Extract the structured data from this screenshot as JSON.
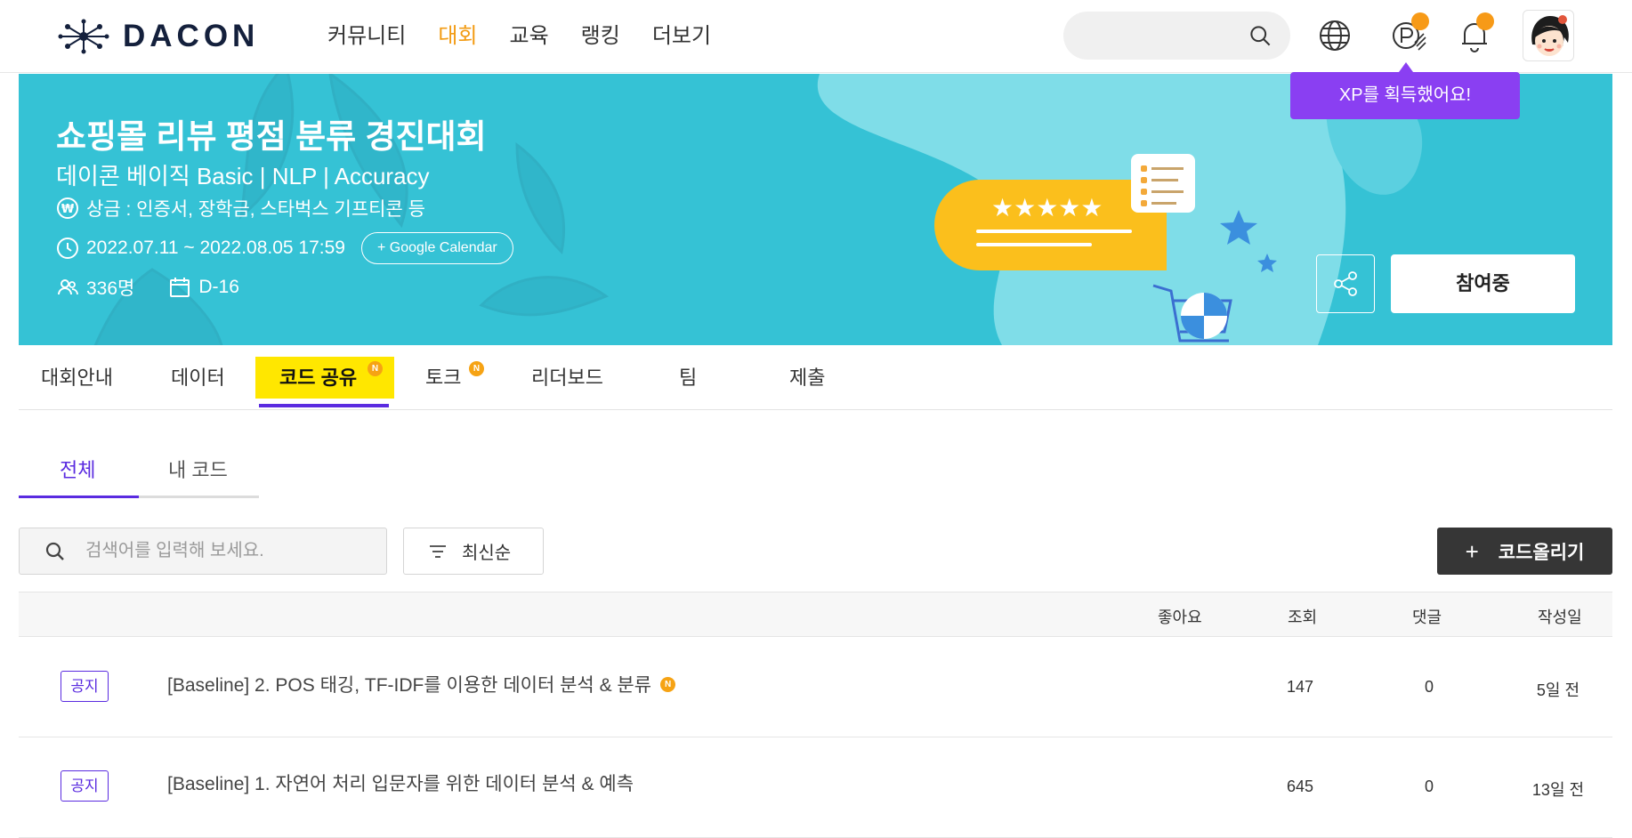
{
  "header": {
    "logo_text": "DACON",
    "menu": [
      "커뮤니티",
      "대회",
      "교육",
      "랭킹",
      "더보기"
    ],
    "xp_tooltip": "XP를 획득했어요!"
  },
  "banner": {
    "title": "쇼핑몰 리뷰 평점 분류 경진대회",
    "subtitle": "데이콘 베이직 Basic | NLP | Accuracy",
    "prize": "상금 : 인증서, 장학금, 스타벅스 기프티콘 등",
    "period": "2022.07.11 ~ 2022.08.05 17:59",
    "calendar_button": "+ Google Calendar",
    "participants": "336명",
    "dday": "D-16",
    "join_button": "참여중",
    "colors": {
      "background": "#35c2d5",
      "card": "#fbbf1c"
    }
  },
  "tabs": {
    "items": [
      "대회안내",
      "데이터",
      "코드 공유",
      "토크",
      "리더보드",
      "팀",
      "제출"
    ],
    "selected": "코드 공유",
    "badge": "N"
  },
  "subtabs": [
    "전체",
    "내 코드"
  ],
  "toolbar": {
    "search_placeholder": "검색어를 입력해 보세요.",
    "sort_label": "최신순",
    "upload_label": "코드올리기"
  },
  "table": {
    "headers": [
      "좋아요",
      "조회",
      "댓글",
      "작성일"
    ],
    "rows": [
      {
        "badge": "공지",
        "title": "[Baseline] 2. POS 태깅, TF-IDF를 이용한 데이터 분석 & 분류",
        "new": "N",
        "views": "147",
        "comments": "0",
        "date": "5일 전"
      },
      {
        "badge": "공지",
        "title": "[Baseline] 1. 자연어 처리 입문자를 위한 데이터 분석 & 예측",
        "views": "645",
        "comments": "0",
        "date": "13일 전"
      }
    ]
  },
  "accent": {
    "orange": "#f29b13",
    "purple": "#5a2be0",
    "tooltip": "#8a3ff2",
    "highlight": "#ffe700"
  }
}
